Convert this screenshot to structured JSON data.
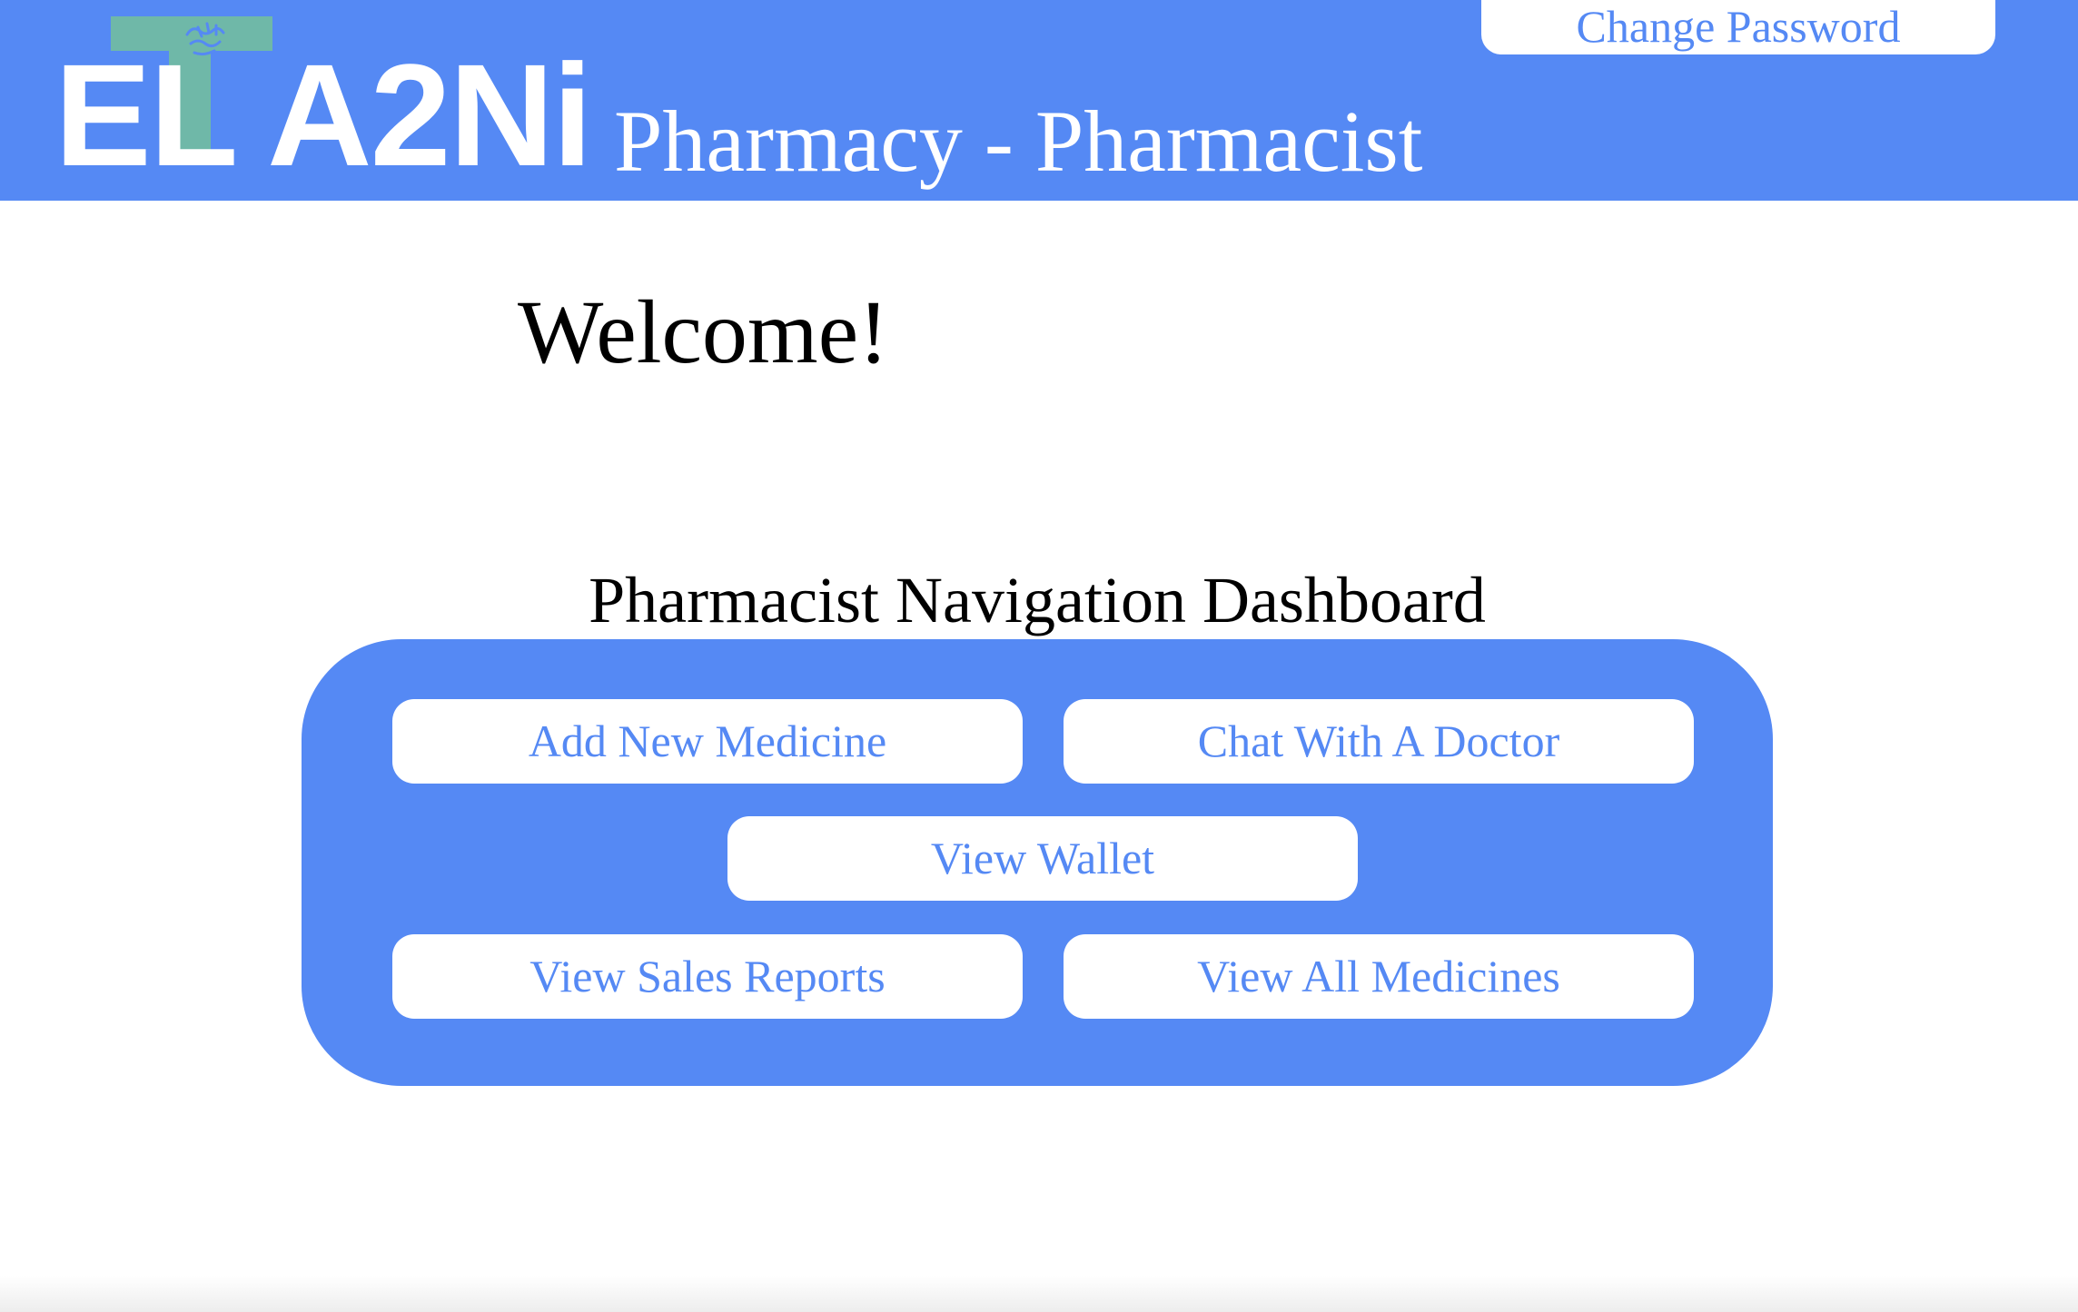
{
  "header": {
    "logo_text": "EL A2Ni",
    "title": "Pharmacy - Pharmacist",
    "change_password_label": "Change Password"
  },
  "main": {
    "welcome": "Welcome!",
    "dashboard_title": "Pharmacist Navigation Dashboard",
    "buttons": [
      {
        "label": "Add New Medicine"
      },
      {
        "label": "Chat With A Doctor"
      },
      {
        "label": "View Wallet"
      },
      {
        "label": "View Sales Reports"
      },
      {
        "label": "View All Medicines"
      }
    ]
  },
  "colors": {
    "brand_blue": "#5589f4",
    "logo_cross": "#6fb8a8",
    "white": "#ffffff"
  },
  "icons": [
    "medical-cross-logo-icon",
    "hands-icon"
  ]
}
